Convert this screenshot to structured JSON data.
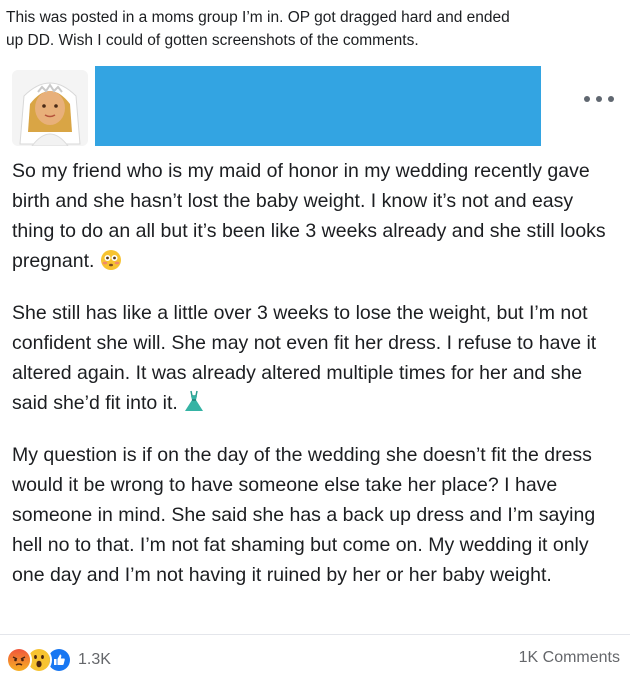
{
  "caption": {
    "line1": "This was posted in a moms group I’m in. OP got dragged hard and ended",
    "line2": "up DD. Wish I could of gotten screenshots of the comments."
  },
  "post": {
    "avatar_icon": "bride-emoji-avatar",
    "more_icon": "more-options-icon",
    "redaction_color": "#33a4e2",
    "paragraphs": [
      {
        "text": "So my friend who is my maid of honor in my wedding recently gave birth and she hasn’t lost the baby weight. I know it’s not and easy thing to do an all but it’s been like 3 weeks already and she still looks pregnant.",
        "emoji": "flushed-face-emoji"
      },
      {
        "text": "She still has like a little over 3 weeks to lose the weight, but I’m not confident she will. She may not even fit her dress. I refuse to have it altered again. It was already altered multiple times for her and she said she’d fit into it.",
        "emoji": "dress-emoji"
      },
      {
        "text": "My question is if on the day of the wedding she doesn’t fit the dress would it be wrong to have someone else take her place? I have someone in mind. She said she has a back up dress and I’m saying hell no to that. I’m not fat shaming but come on. My wedding it only one day and I’m not having it ruined by her or her baby weight.",
        "emoji": ""
      }
    ]
  },
  "footer": {
    "reactions": [
      "angry-reaction-icon",
      "wow-reaction-icon",
      "like-reaction-icon"
    ],
    "reaction_count": "1.3K",
    "comments": "1K Comments"
  }
}
